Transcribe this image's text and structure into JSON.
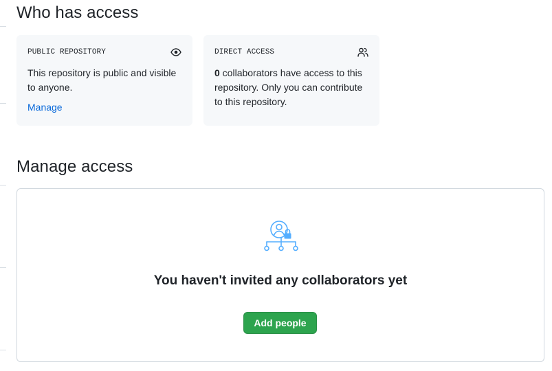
{
  "who_has_access": {
    "title": "Who has access",
    "public_card": {
      "label": "PUBLIC REPOSITORY",
      "icon": "eye-icon",
      "text": "This repository is public and visible to anyone.",
      "link": "Manage"
    },
    "direct_card": {
      "label": "DIRECT ACCESS",
      "icon": "people-icon",
      "count": "0",
      "text": " collaborators have access to this repository. Only you can contribute to this repository."
    }
  },
  "manage_access": {
    "title": "Manage access",
    "blankslate_icon": "collaborators-lock-icon",
    "message": "You haven't invited any collaborators yet",
    "button_label": "Add people"
  },
  "colors": {
    "link": "#0969da",
    "primary_button": "#2da44e",
    "card_background": "#f6f8fa",
    "illustration": "#54aeff"
  }
}
